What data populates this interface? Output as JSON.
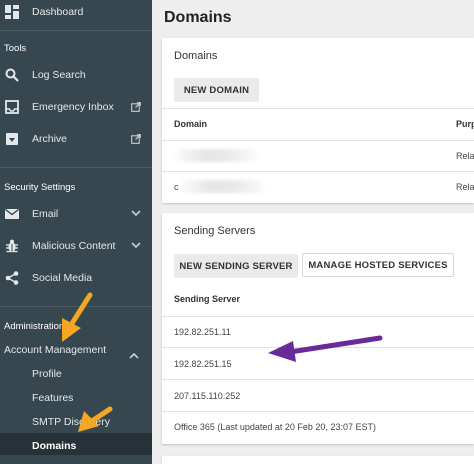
{
  "sidebar": {
    "dashboard_label": "Dashboard",
    "tools_header": "Tools",
    "log_search_label": "Log Search",
    "emergency_inbox_label": "Emergency Inbox",
    "archive_label": "Archive",
    "security_header": "Security Settings",
    "email_label": "Email",
    "malicious_content_label": "Malicious Content",
    "social_media_label": "Social Media",
    "administration_header": "Administration",
    "account_management_label": "Account Management",
    "sub_items": [
      "Profile",
      "Features",
      "SMTP Discovery",
      "Domains"
    ],
    "active_item": "Domains"
  },
  "main": {
    "page_title": "Domains",
    "domains_card": {
      "title": "Domains",
      "new_button": "NEW DOMAIN",
      "columns": [
        "Domain",
        "Purp"
      ],
      "rows": [
        {
          "domain": "",
          "purpose": "Relat"
        },
        {
          "domain": "c",
          "purpose": "Relat"
        }
      ]
    },
    "sending_card": {
      "title": "Sending Servers",
      "new_button": "NEW SENDING SERVER",
      "manage_button": "MANAGE HOSTED SERVICES",
      "column": "Sending Server",
      "rows": [
        "192.82.251.11",
        "192.82.251.15",
        "207.115.110.252",
        "Office 365 (Last updated at 20 Feb 20, 23:07 EST)"
      ]
    }
  },
  "colors": {
    "sidebar_bg": "#37474f",
    "sidebar_active_bg": "#263238",
    "annotation_orange": "#f5a623",
    "annotation_purple": "#6a2a9a"
  }
}
